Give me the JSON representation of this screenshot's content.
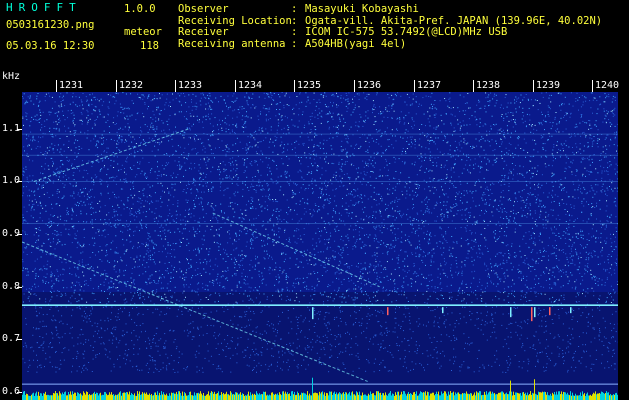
{
  "app": {
    "name": "HROFFT",
    "version": "1.0.0"
  },
  "file": {
    "name": "0503161230.png",
    "datetime": "05.03.16 12:30"
  },
  "meteor": {
    "label": "meteor",
    "count": "118"
  },
  "info": [
    {
      "key": "Observer",
      "value": "Masayuki Kobayashi"
    },
    {
      "key": "Receiving Location",
      "value": "Ogata-vill. Akita-Pref. JAPAN (139.96E, 40.02N)"
    },
    {
      "key": "Receiver",
      "value": "ICOM IC-575 53.7492(@LCD)MHz USB"
    },
    {
      "key": "Receiving antenna",
      "value": "A504HB(yagi 4el)"
    }
  ],
  "axis": {
    "y_unit": "kHz",
    "y_ticks": [
      "1.1",
      "1.0",
      "0.9",
      "0.8",
      "0.7",
      "0.6"
    ],
    "y_range": [
      0.6,
      1.17
    ],
    "time_ticks": [
      "1231",
      "1232",
      "1233",
      "1234",
      "1235",
      "1236",
      "1237",
      "1238",
      "1239",
      "1240"
    ]
  },
  "colors": {
    "background": "#0a1a8c",
    "noise": "#3fa6ff",
    "carrier": "#7ff0ff",
    "text": "#ffff3c",
    "title": "#00ffd8"
  },
  "spectrogram": {
    "carrier_khz": 0.765,
    "baseline_khz": 0.615,
    "diagonal_traces": [
      {
        "from": [
          1230.0,
          0.885
        ],
        "to": [
          1235.8,
          0.62
        ]
      },
      {
        "from": [
          1233.2,
          0.94
        ],
        "to": [
          1236.0,
          0.8
        ]
      },
      {
        "from": [
          1230.2,
          1.0
        ],
        "to": [
          1232.8,
          1.1
        ]
      }
    ]
  }
}
